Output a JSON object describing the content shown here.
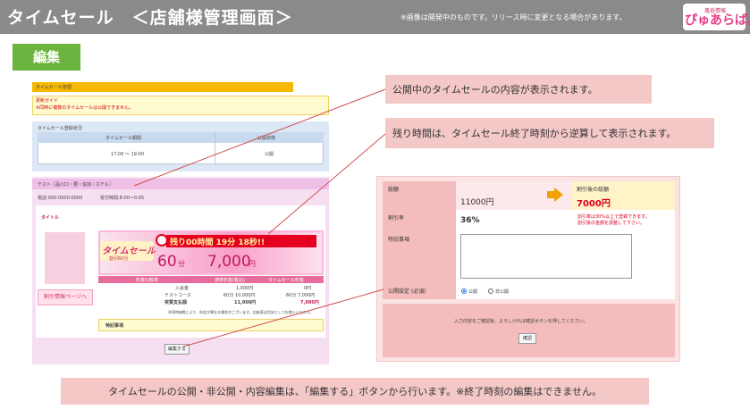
{
  "header": {
    "title": "タイムセール　＜店舗様管理画面＞",
    "note": "※画像は開発中のものです。リリース時に変更となる場合があります。",
    "logo_small": "風俗情報",
    "logo_main": "ぴゅあらば。"
  },
  "badge": "編集",
  "admin": {
    "section_title": "タイムセール管理",
    "guide_label": "更新ガイド",
    "guide_note": "※同時に複数のタイムセールは公開できません。",
    "status_title": "タイムセール登録状況",
    "col_period": "タイムセール期間",
    "col_status": "公開状態",
    "period_value": "17:00 ～ 19:00",
    "status_value": "公開",
    "shop_head": "テスト［品川口・要・追加・ホテル］",
    "phone": "電話:000-0000-0000",
    "hours": "受付時間:8:00～0:05",
    "course_title": "タイトル",
    "page_button": "割引情報ページへ",
    "banner_text": "タイムセール",
    "banner_sub": "割引60分",
    "timer": "残り00時間 19分 18秒!!",
    "minutes": "60",
    "minutes_unit": "分",
    "price": "7,000",
    "price_unit": "円",
    "tabs": [
      "料金比較表",
      "通常料金(税込)",
      "タイムセール料金"
    ],
    "rows": [
      {
        "label": "入会金",
        "normal": "1,000円",
        "sale": "0円"
      },
      {
        "label": "テストコース",
        "normal": "60分 10,000円",
        "sale": "60分 7,000円"
      },
      {
        "label": "実質支払額",
        "normal": "11,000円",
        "sale": "7,000円"
      }
    ],
    "price_note": "※同時納期により、料金が異なる場合がございます。比較表は目安としてお使いください。",
    "memo_label": "特記事項",
    "edit_button": "編集する"
  },
  "callouts": {
    "c1": "公開中のタイムセールの内容が表示されます。",
    "c2": "残り時間は、タイムセール終了時刻から逆算して表示されます。",
    "c3": "タイムセールの公開・非公開・内容編集は、「編集する」ボタンから行います。※終了時刻の編集はできません。"
  },
  "form": {
    "total_label": "総額",
    "total_value": "11000円",
    "discount_total_label": "割引後の総額",
    "discount_total_value": "7000円",
    "rate_label": "割引率",
    "rate_value": "36%",
    "rate_note1": "割引率は30%以上で登録できます。",
    "rate_note2": "割引後の金額を調整して下さい。",
    "memo_label": "特記事項",
    "publish_label": "公開設定",
    "publish_required": "(必須)",
    "opt_public": "公開",
    "opt_private": "非公開",
    "confirm_msg": "入力内容をご確認後、よろしければ確認ボタンを押してください。",
    "confirm_button": "確認"
  }
}
